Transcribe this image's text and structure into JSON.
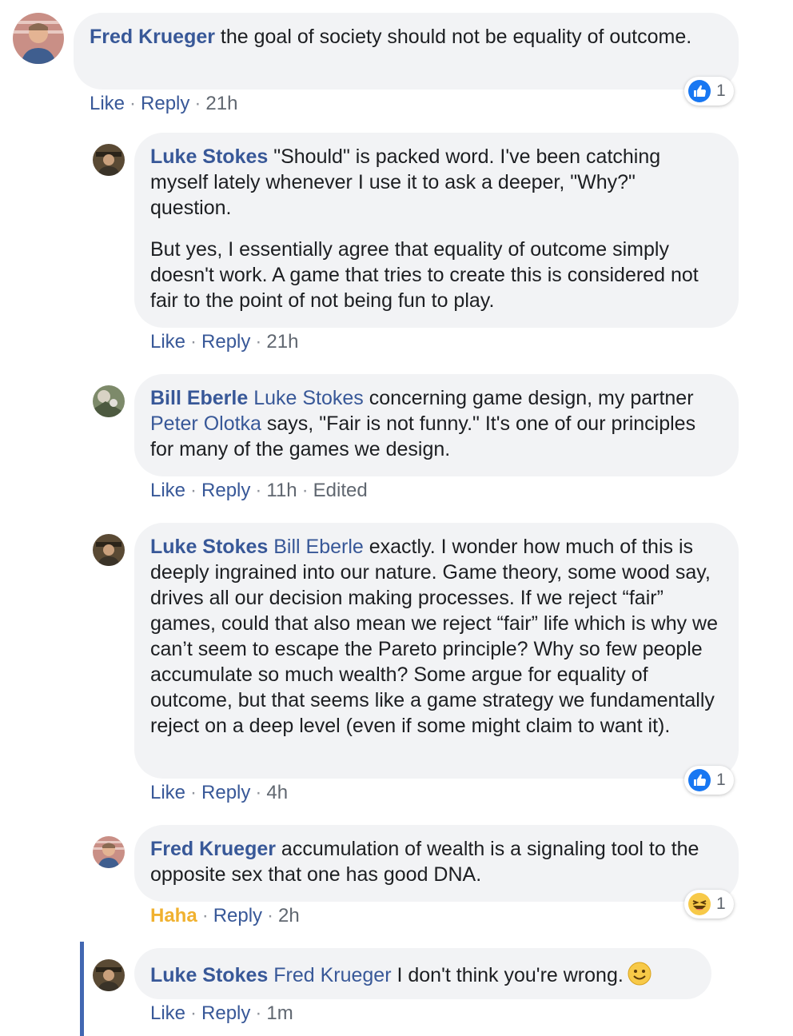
{
  "comments": [
    {
      "author": "Fred Krueger",
      "text": " the goal of society should not be equality of outcome.",
      "like": "Like",
      "reply": "Reply",
      "time": "21h",
      "reaction_count": "1",
      "reaction_type": "like"
    },
    {
      "author": "Luke Stokes",
      "text": " \"Should\" is packed word. I've been catching myself lately whenever I use it to ask a deeper, \"Why?\" question.",
      "text2": "But yes, I essentially agree that equality of outcome simply doesn't work. A game that tries to create this is considered not fair to the point of not being fun to play.",
      "like": "Like",
      "reply": "Reply",
      "time": "21h"
    },
    {
      "author": "Bill Eberle",
      "mention": "Luke Stokes",
      "text": " concerning game design, my partner ",
      "mention2": "Peter Olotka",
      "text2": " says, \"Fair is not funny.\" It's one of our principles for many of the games we design.",
      "like": "Like",
      "reply": "Reply",
      "time": "11h",
      "edited": "Edited"
    },
    {
      "author": "Luke Stokes",
      "mention": "Bill Eberle",
      "text": " exactly. I wonder how much of this is deeply ingrained into our nature. Game theory, some wood say, drives all our decision making processes. If we reject “fair” games, could that also mean we reject “fair” life which is why we can’t seem to escape the Pareto principle? Why so few people accumulate so much wealth? Some argue for equality of outcome, but that seems like a game strategy we fundamentally reject on a deep level (even if some might claim to want it).",
      "like": "Like",
      "reply": "Reply",
      "time": "4h",
      "reaction_count": "1",
      "reaction_type": "like"
    },
    {
      "author": "Fred Krueger",
      "text": " accumulation of wealth is a signaling tool to the opposite sex that one has good DNA.",
      "like": "Haha",
      "reply": "Reply",
      "time": "2h",
      "reaction_count": "1",
      "reaction_type": "haha"
    },
    {
      "author": "Luke Stokes",
      "mention": "Fred Krueger",
      "text": " I don't think you're wrong.",
      "emoji": "smiley-emoji",
      "like": "Like",
      "reply": "Reply",
      "time": "1m"
    }
  ],
  "separator": "·",
  "colors": {
    "link": "#385898",
    "bubble": "#f2f3f5",
    "meta": "#606770",
    "haha": "#f0b12f",
    "thread_line": "#4267b2",
    "like_blue": "#1877f2"
  }
}
